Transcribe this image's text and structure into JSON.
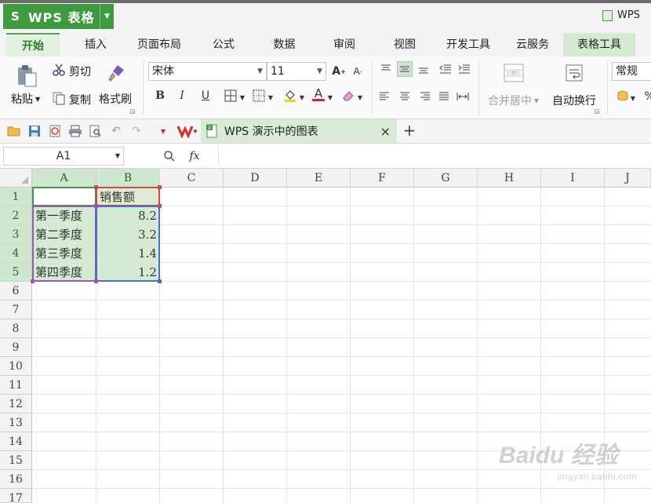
{
  "app": {
    "logo": "S",
    "title": "WPS 表格",
    "window_title": "WPS"
  },
  "menu_tabs": [
    "开始",
    "插入",
    "页面布局",
    "公式",
    "数据",
    "审阅",
    "视图",
    "开发工具",
    "云服务",
    "表格工具"
  ],
  "ribbon": {
    "paste": "粘贴",
    "cut": "剪切",
    "copy": "复制",
    "format_painter": "格式刷",
    "font_name": "宋体",
    "font_size": "11",
    "bold": "B",
    "italic": "I",
    "underline": "U",
    "merge_center": "合并居中",
    "wrap_text": "自动换行",
    "number_format": "常规",
    "percent": "%"
  },
  "qat": {
    "doc_tab": "WPS 演示中的图表",
    "close": "×",
    "new_tab": "+"
  },
  "formula_bar": {
    "name_box": "A1",
    "fx": "fx"
  },
  "columns": [
    "A",
    "B",
    "C",
    "D",
    "E",
    "F",
    "G",
    "H",
    "I",
    "J"
  ],
  "rows": [
    "1",
    "2",
    "3",
    "4",
    "5",
    "6",
    "7",
    "8",
    "9",
    "10",
    "11",
    "12",
    "13",
    "14",
    "15",
    "16",
    "17"
  ],
  "cells": {
    "B1": "销售额",
    "A2": "第一季度",
    "B2": "8.2",
    "A3": "第二季度",
    "B3": "3.2",
    "A4": "第三季度",
    "B4": "1.4",
    "A5": "第四季度",
    "B5": "1.2"
  },
  "watermark": {
    "brand": "Baidu 经验",
    "url": "jingyan.baidu.com"
  },
  "colors": {
    "accent": "#3f9a3f",
    "selection_fill": "#d4ead3",
    "range_border": "#9b59b6"
  }
}
